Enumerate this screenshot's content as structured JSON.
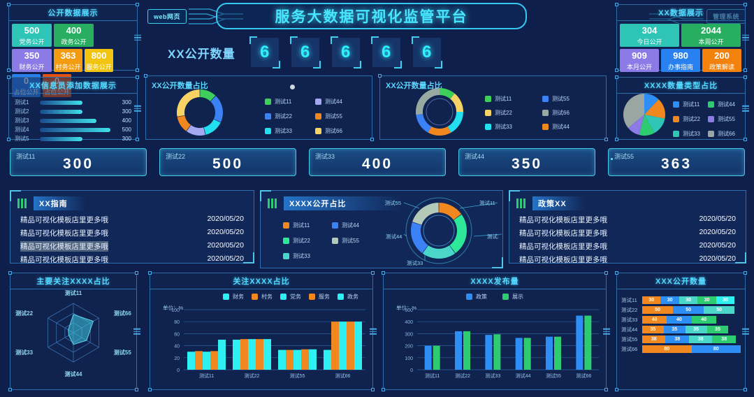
{
  "header": {
    "title": "服务大数据可视化监管平台",
    "left_button": "web网页",
    "right_button": "管理系统"
  },
  "number_display": {
    "label": "XX公开数量",
    "digits": [
      "6",
      "6",
      "6",
      "6",
      "6"
    ]
  },
  "public_data_panel": {
    "title": "公开数据展示",
    "tiles": [
      {
        "value": "500",
        "label": "党务公开",
        "color": "#2ec4b6"
      },
      {
        "value": "400",
        "label": "政务公开",
        "color": "#27ae60"
      },
      {
        "value": "350",
        "label": "财务公开",
        "color": "#8c7ae6"
      },
      {
        "value": "363",
        "label": "村务公开",
        "color": "#f39c12"
      },
      {
        "value": "800",
        "label": "服务公开",
        "color": "#f1c40f"
      },
      {
        "value": "0",
        "label": "占位公开",
        "color": "#2980ef"
      },
      {
        "value": "0",
        "label": "占位公开",
        "color": "#e8500e"
      }
    ]
  },
  "xx_data_panel": {
    "title": "XX数据展示",
    "tiles": [
      {
        "value": "304",
        "label": "今日公开",
        "color": "#2ec4b6"
      },
      {
        "value": "2044",
        "label": "本周公开",
        "color": "#27ae60"
      },
      {
        "value": "909",
        "label": "本月公开",
        "color": "#8c7ae6"
      },
      {
        "value": "980",
        "label": "办事指南",
        "color": "#2980ef"
      },
      {
        "value": "200",
        "label": "政策解读",
        "color": "#f3820c"
      }
    ]
  },
  "info_panel": {
    "title": "XX信息员添加数据展示",
    "rows": [
      {
        "name": "测试1",
        "value": 300
      },
      {
        "name": "测试2",
        "value": 300
      },
      {
        "name": "测试3",
        "value": 400
      },
      {
        "name": "测试4",
        "value": 500
      },
      {
        "name": "测试5",
        "value": 300
      }
    ],
    "max": 500
  },
  "donut_one": {
    "title": "XX公开数量占比",
    "legend": [
      "测试11",
      "测试44",
      "测试22",
      "测试55",
      "测试33",
      "测试66"
    ],
    "chart_data": {
      "type": "pie",
      "title": "XX公开数量占比",
      "categories": [
        "测试11",
        "测试22",
        "测试33",
        "测试44",
        "测试55",
        "测试66"
      ],
      "values": [
        12,
        20,
        14,
        14,
        12,
        28
      ],
      "colors": [
        "#3ecf5a",
        "#3b82f6",
        "#22e0f0",
        "#a3a8f0",
        "#f0871f",
        "#f7d264"
      ]
    }
  },
  "donut_two": {
    "title": "XX公开数量占比",
    "legend": [
      "测试11",
      "测试55",
      "测试22",
      "测试66",
      "测试33",
      "测试44"
    ],
    "chart_data": {
      "type": "pie",
      "title": "XX公开数量占比",
      "categories": [
        "测试11",
        "测试22",
        "测试33",
        "测试44",
        "测试55",
        "测试66"
      ],
      "values": [
        11,
        14,
        17,
        16,
        15,
        27
      ],
      "colors": [
        "#3ecf5a",
        "#f7d264",
        "#22e0f0",
        "#f0871f",
        "#3b82f6",
        "#98a9a1"
      ]
    }
  },
  "pie_panel": {
    "title": "XXXX数量类型占比",
    "legend": [
      "测试11",
      "测试44",
      "测试22",
      "测试55",
      "测试33",
      "测试66"
    ],
    "chart_data": {
      "type": "pie",
      "title": "XXXX数量类型占比",
      "categories": [
        "测试11",
        "测试22",
        "测试33",
        "测试44",
        "测试55",
        "测试66"
      ],
      "values": [
        12,
        16,
        14,
        12,
        10,
        36
      ],
      "colors": [
        "#2d8ef5",
        "#f0871f",
        "#2ec4b6",
        "#2ecc71",
        "#8c7ae6",
        "#9aa6a2"
      ]
    }
  },
  "kpis": [
    {
      "label": "测试11",
      "value": "300"
    },
    {
      "label": "测试22",
      "value": "500"
    },
    {
      "label": "测试33",
      "value": "400"
    },
    {
      "label": "测试44",
      "value": "350"
    },
    {
      "label": "测试55",
      "value": "363"
    }
  ],
  "guide_panel": {
    "title": "XX指南",
    "rows": [
      {
        "text": "精品可视化模板店里更多哦",
        "date": "2020/05/20",
        "highlighted": false
      },
      {
        "text": "精品可视化模板店里更多哦",
        "date": "2020/05/20",
        "highlighted": false
      },
      {
        "text": "精品可视化模板店里更多哦",
        "date": "2020/05/20",
        "highlighted": true
      },
      {
        "text": "精品可视化模板店里更多哦",
        "date": "2020/05/20",
        "highlighted": false
      }
    ]
  },
  "policy_panel": {
    "title": "政策XX",
    "rows": [
      {
        "text": "精品可视化模板店里更多哦",
        "date": "2020/05/20",
        "highlighted": false
      },
      {
        "text": "精品可视化模板店里更多哦",
        "date": "2020/05/20",
        "highlighted": false
      },
      {
        "text": "精品可视化模板店里更多哦",
        "date": "2020/05/20",
        "highlighted": false
      },
      {
        "text": "精品可视化模板店里更多哦",
        "date": "2020/05/20",
        "highlighted": false
      }
    ]
  },
  "ratio_panel": {
    "title": "XXXX公开占比",
    "legend": [
      "测试11",
      "测试44",
      "测试22",
      "测试55",
      "测试33"
    ],
    "labels": [
      "测试55",
      "测试11",
      "测试44",
      "测试:",
      "测试33"
    ],
    "chart_data": {
      "type": "pie",
      "title": "XXXX公开占比",
      "categories": [
        "测试11",
        "测试22",
        "测试33",
        "测试44",
        "测试55"
      ],
      "values": [
        15,
        25,
        20,
        20,
        20
      ],
      "colors": [
        "#f0871f",
        "#2ee89a",
        "#4ad6c8",
        "#3b82f6",
        "#b5c9b8"
      ]
    }
  },
  "radar_panel": {
    "title": "主要关注XXXX占比",
    "chart_data": {
      "type": "radar",
      "title": "主要关注XXXX占比",
      "categories": [
        "测试11",
        "测试66",
        "测试55",
        "测试44",
        "测试33",
        "测试22"
      ],
      "values": [
        62,
        78,
        52,
        40,
        18,
        20
      ],
      "max": 100
    }
  },
  "focus_bar_panel": {
    "title": "关注XXXX占比",
    "unit": "单位：%",
    "chart_data": {
      "type": "bar",
      "title": "关注XXXX占比",
      "unit": "单位：%",
      "categories": [
        "测试11",
        "测试22",
        "测试55",
        "测试66"
      ],
      "series": [
        {
          "name": "财务",
          "color": "#2ff0f0",
          "values": [
            30,
            50,
            33,
            33
          ]
        },
        {
          "name": "村务",
          "color": "#f0871f",
          "values": [
            31,
            51,
            33,
            80
          ]
        },
        {
          "name": "党务",
          "color": "#2ff0f0",
          "values": [
            30,
            51,
            33,
            80
          ]
        },
        {
          "name": "服务",
          "color": "#f0871f",
          "values": [
            31,
            51,
            34,
            80
          ]
        },
        {
          "name": "政务",
          "color": "#2ff0f0",
          "values": [
            50,
            51,
            34,
            80
          ]
        }
      ],
      "yticks": [
        "0",
        "20",
        "40",
        "60",
        "80",
        "100"
      ],
      "ylim": [
        0,
        100
      ]
    }
  },
  "publish_panel": {
    "title": "XXXX发布量",
    "unit": "单位：%",
    "chart_data": {
      "type": "bar",
      "title": "XXXX发布量",
      "unit": "单位：%",
      "categories": [
        "测试11",
        "测试22",
        "测试33",
        "测试44",
        "测试55",
        "测试66"
      ],
      "series": [
        {
          "name": "政策",
          "color": "#2d8ef5",
          "values": [
            200,
            320,
            290,
            265,
            275,
            450
          ]
        },
        {
          "name": "展示",
          "color": "#2ecc71",
          "values": [
            200,
            320,
            295,
            265,
            275,
            450
          ]
        }
      ],
      "yticks": [
        "0",
        "100",
        "200",
        "300",
        "400",
        "500"
      ],
      "ylim": [
        0,
        500
      ]
    }
  },
  "stacked_panel": {
    "title": "XXX公开数量",
    "chart_data": {
      "type": "bar",
      "title": "XXX公开数量",
      "categories": [
        "测试11",
        "测试22",
        "测试33",
        "测试44",
        "测试55",
        "测试66"
      ],
      "stacks": [
        {
          "category": "测试11",
          "values": [
            30,
            30,
            30,
            30,
            30
          ],
          "colors": [
            "#f0871f",
            "#2d8ef5",
            "#4ad6c8",
            "#2ecc71",
            "#2ff0f0"
          ]
        },
        {
          "category": "测试22",
          "values": [
            50,
            50,
            50
          ],
          "colors": [
            "#f0871f",
            "#2d8ef5",
            "#4ad6c8"
          ]
        },
        {
          "category": "测试33",
          "values": [
            40,
            40,
            40
          ],
          "colors": [
            "#f0871f",
            "#2d8ef5",
            "#2ecc71"
          ]
        },
        {
          "category": "测试44",
          "values": [
            35,
            35,
            35,
            35
          ],
          "colors": [
            "#f0871f",
            "#2d8ef5",
            "#4ad6c8",
            "#2ecc71"
          ]
        },
        {
          "category": "测试55",
          "values": [
            38,
            38,
            38,
            38
          ],
          "colors": [
            "#f0871f",
            "#2d8ef5",
            "#4ad6c8",
            "#2ecc71"
          ]
        },
        {
          "category": "测试66",
          "values": [
            80,
            80
          ],
          "colors": [
            "#f0871f",
            "#2d8ef5"
          ]
        }
      ]
    }
  }
}
